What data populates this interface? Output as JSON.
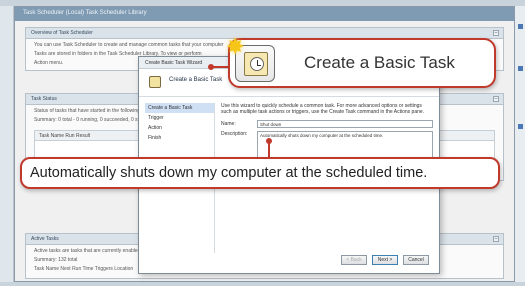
{
  "outer_window": {
    "title": "Task Scheduler (Local)  Task Scheduler Library"
  },
  "overview_panel": {
    "header": "Overview of Task Scheduler",
    "line1": "You can use Task Scheduler to create and manage common tasks that your computer",
    "line2": "Tasks are stored in folders in the Task Scheduler Library. To view or perform",
    "line3": "Action menu."
  },
  "status_panel": {
    "header": "Task Status",
    "line1": "Status of tasks that have started in the following time period:",
    "line2": "Summary: 0 total - 0 running, 0 succeeded, 0 stopped, 0 failed",
    "table_header": "Task Name          Run Result"
  },
  "active_panel": {
    "header": "Active Tasks",
    "line1": "Active tasks are tasks that are currently enabled and have not expired.",
    "line2": "Summary: 132 total",
    "table_header": "Task Name                Next Run Time         Triggers          Location"
  },
  "wizard": {
    "title": "Create Basic Task Wizard",
    "heading": "Create a Basic Task",
    "nav": [
      "Create a Basic Task",
      "Trigger",
      "Action",
      "Finish"
    ],
    "intro": "Use this wizard to quickly schedule a common task. For more advanced options or settings such as multiple task actions or triggers, use the Create Task command in the Actions pane.",
    "name_label": "Name:",
    "name_value": "Shut down",
    "description_label": "Description:",
    "description_value": "Automatically shuts down my computer at the scheduled time.",
    "buttons": {
      "back": "< Back",
      "next": "Next >",
      "cancel": "Cancel"
    }
  },
  "callouts": {
    "top": "Create a Basic Task",
    "bottom": "Automatically shuts down my computer at the scheduled time."
  },
  "colors": {
    "callout_border": "#c0392b",
    "titlebar": "#7f9bb3",
    "sparkle": "#f5c518"
  },
  "icons": {
    "task_icon": "calendar-clock-icon",
    "sparkle": "star-burst-icon"
  }
}
